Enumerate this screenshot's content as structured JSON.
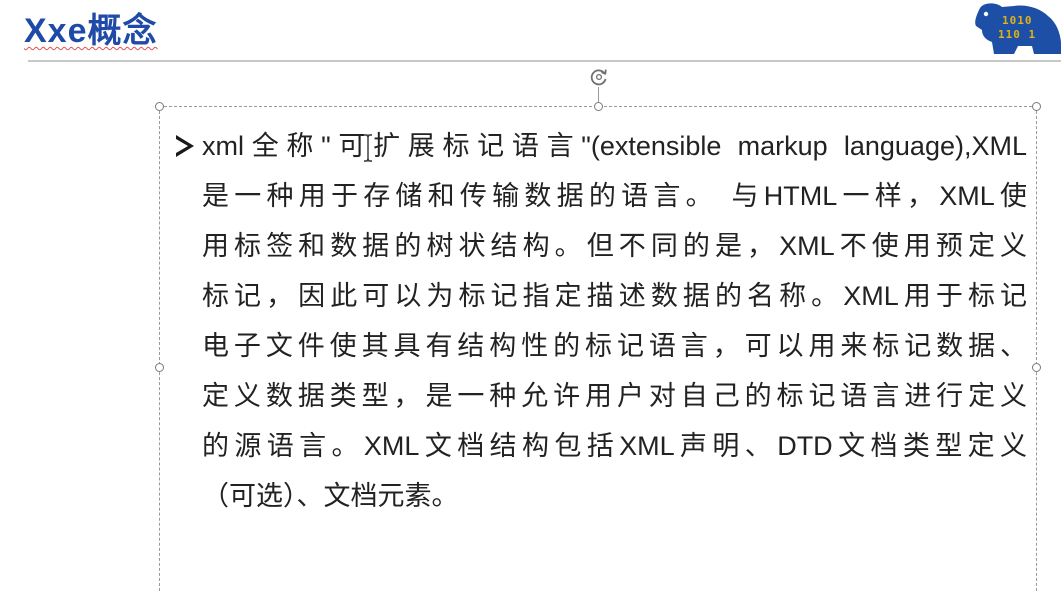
{
  "slide": {
    "title": "Xxe概念",
    "logo": {
      "icon": "binary-beast-logo-icon",
      "digits_row1": "1010",
      "digits_row2": "110 1"
    },
    "body": {
      "bullet_icon": "arrow-bullet-icon",
      "lines": [
        "xml全称\"可扩展标记语言\"(extensible markup language),XML",
        "是一种用于存储和传输数据的语言。 与HTML一样，XML使",
        "用标签和数据的树状结构。但不同的是，XML不使用预定义",
        "标记，因此可以为标记指定描述数据的名称。XML用于标记",
        "电子文件使其具有结构性的标记语言，可以用来标记数据、",
        "定义数据类型，是一种允许用户对自己的标记语言进行定义",
        "的源语言。XML文档结构包括XML声明、DTD文档类型定义",
        "（可选）、文档元素。"
      ]
    }
  },
  "colors": {
    "title": "#1f4aa8",
    "body_text": "#222222",
    "logo_blue": "#1d4fa6",
    "logo_gold": "#e0b21a"
  }
}
